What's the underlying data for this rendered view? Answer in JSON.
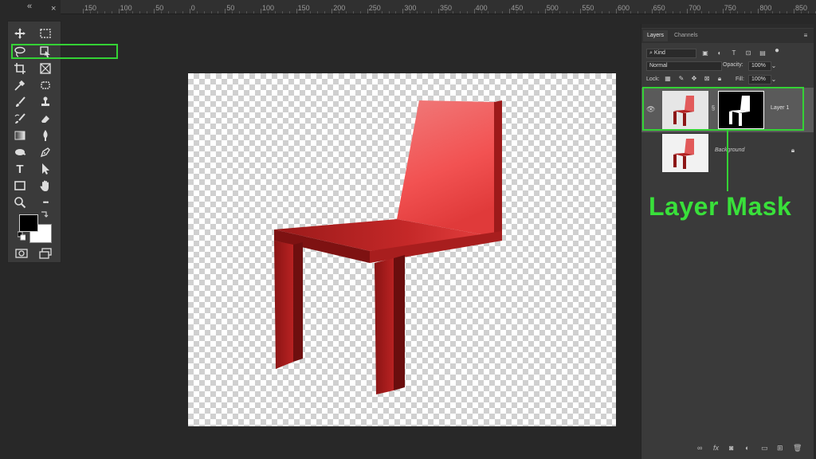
{
  "ruler": {
    "labels": [
      "150",
      "100",
      "50",
      "0",
      "50",
      "100",
      "150",
      "200",
      "250",
      "300",
      "350",
      "400",
      "450",
      "500",
      "550",
      "600",
      "650",
      "700",
      "750",
      "800",
      "850"
    ]
  },
  "toolbar": {
    "collapse_glyph": "«",
    "close_glyph": "×",
    "tools": [
      {
        "name": "move-tool",
        "icon": "move-icon"
      },
      {
        "name": "marquee-tool",
        "icon": "marquee-icon"
      },
      {
        "name": "lasso-tool",
        "icon": "lasso-icon"
      },
      {
        "name": "object-selection-tool",
        "icon": "object-selection-icon"
      },
      {
        "name": "crop-tool",
        "icon": "crop-icon"
      },
      {
        "name": "frame-tool",
        "icon": "frame-icon"
      },
      {
        "name": "eyedropper-tool",
        "icon": "eyedropper-icon"
      },
      {
        "name": "spot-healing-tool",
        "icon": "healing-icon"
      },
      {
        "name": "brush-tool",
        "icon": "brush-icon"
      },
      {
        "name": "stamp-tool",
        "icon": "stamp-icon"
      },
      {
        "name": "history-brush-tool",
        "icon": "history-brush-icon"
      },
      {
        "name": "eraser-tool",
        "icon": "eraser-icon"
      },
      {
        "name": "gradient-tool",
        "icon": "gradient-icon"
      },
      {
        "name": "blur-tool",
        "icon": "blur-icon"
      },
      {
        "name": "dodge-tool",
        "icon": "dodge-icon"
      },
      {
        "name": "pen-tool",
        "icon": "pen-icon"
      },
      {
        "name": "type-tool",
        "icon": "type-icon"
      },
      {
        "name": "path-selection-tool",
        "icon": "arrow-icon"
      },
      {
        "name": "rectangle-tool",
        "icon": "rectangle-icon"
      },
      {
        "name": "hand-tool",
        "icon": "hand-icon"
      },
      {
        "name": "zoom-tool",
        "icon": "zoom-icon"
      },
      {
        "name": "more-tools",
        "icon": "more-icon"
      }
    ],
    "type_glyph": "T",
    "more_glyph": "•••",
    "fg_color": "#000000",
    "bg_color": "#ffffff"
  },
  "layers_panel": {
    "tabs": [
      "Layers",
      "Channels"
    ],
    "filter_label": "Kind",
    "blend_mode": "Normal",
    "opacity_label": "Opacity:",
    "opacity_value": "100%",
    "lock_label": "Lock:",
    "fill_label": "Fill:",
    "fill_value": "100%",
    "layers": [
      {
        "name": "Layer 1",
        "selected": true,
        "has_mask": true
      },
      {
        "name": "Background",
        "selected": false,
        "has_mask": false
      }
    ],
    "bottom_icons": [
      "link-icon",
      "fx-icon",
      "mask-icon",
      "adjustment-icon",
      "group-icon",
      "new-layer-icon",
      "trash-icon"
    ],
    "fx_label": "fx"
  },
  "annotation": {
    "callout_text": "Layer Mask",
    "highlight_color": "#34d235"
  }
}
